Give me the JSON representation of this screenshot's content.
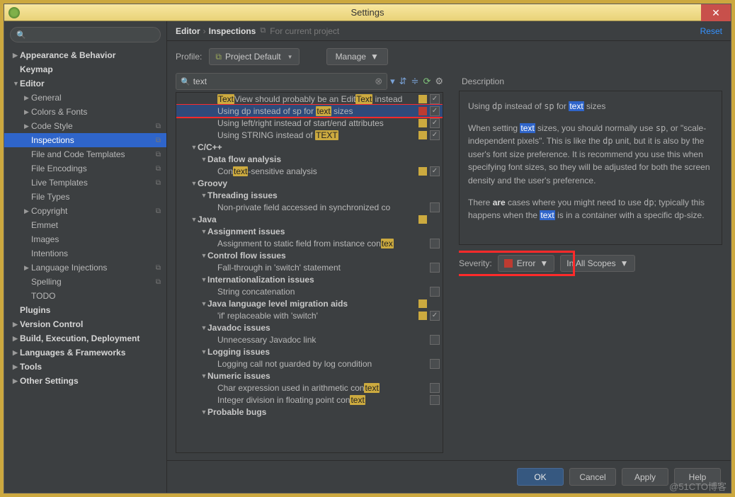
{
  "window": {
    "title": "Settings"
  },
  "breadcrumb": {
    "a": "Editor",
    "b": "Inspections",
    "proj": "For current project"
  },
  "reset": "Reset",
  "profile": {
    "label": "Profile:",
    "value": "Project Default"
  },
  "manage": "Manage",
  "search": {
    "value": "text"
  },
  "sidebar": {
    "items": [
      {
        "l": "Appearance & Behavior",
        "d": 0,
        "a": "▶",
        "b": 1
      },
      {
        "l": "Keymap",
        "d": 0,
        "b": 1
      },
      {
        "l": "Editor",
        "d": 0,
        "a": "▼",
        "b": 1
      },
      {
        "l": "General",
        "d": 1,
        "a": "▶"
      },
      {
        "l": "Colors & Fonts",
        "d": 1,
        "a": "▶"
      },
      {
        "l": "Code Style",
        "d": 1,
        "a": "▶",
        "c": 1
      },
      {
        "l": "Inspections",
        "d": 1,
        "sel": 1,
        "c": 1
      },
      {
        "l": "File and Code Templates",
        "d": 1,
        "c": 1
      },
      {
        "l": "File Encodings",
        "d": 1,
        "c": 1
      },
      {
        "l": "Live Templates",
        "d": 1,
        "c": 1
      },
      {
        "l": "File Types",
        "d": 1
      },
      {
        "l": "Copyright",
        "d": 1,
        "a": "▶",
        "c": 1
      },
      {
        "l": "Emmet",
        "d": 1
      },
      {
        "l": "Images",
        "d": 1
      },
      {
        "l": "Intentions",
        "d": 1
      },
      {
        "l": "Language Injections",
        "d": 1,
        "a": "▶",
        "c": 1
      },
      {
        "l": "Spelling",
        "d": 1,
        "c": 1
      },
      {
        "l": "TODO",
        "d": 1
      },
      {
        "l": "Plugins",
        "d": 0,
        "b": 1
      },
      {
        "l": "Version Control",
        "d": 0,
        "a": "▶",
        "b": 1
      },
      {
        "l": "Build, Execution, Deployment",
        "d": 0,
        "a": "▶",
        "b": 1
      },
      {
        "l": "Languages & Frameworks",
        "d": 0,
        "a": "▶",
        "b": 1
      },
      {
        "l": "Tools",
        "d": 0,
        "a": "▶",
        "b": 1
      },
      {
        "l": "Other Settings",
        "d": 0,
        "a": "▶",
        "b": 1
      }
    ]
  },
  "inspections": [
    {
      "d": 3,
      "html": "<span class='hl'>Text</span>View should probably be an Edit<span class='hl'>Text</span> instead",
      "sev": "warn",
      "chk": 1
    },
    {
      "d": 3,
      "html": "Using dp instead of sp for <span class='hl'>text</span> sizes",
      "sev": "err",
      "chk": 1,
      "sel": 1
    },
    {
      "d": 3,
      "html": "Using left/right instead of start/end attributes",
      "sev": "warn",
      "chk": 1
    },
    {
      "d": 3,
      "html": "Using STRING instead of <span class='hl'>TEXT</span>",
      "sev": "warn",
      "chk": 1
    },
    {
      "d": 1,
      "cat": "C/C++",
      "a": "▼"
    },
    {
      "d": 2,
      "cat": "Data flow analysis",
      "a": "▼"
    },
    {
      "d": 3,
      "html": "Con<span class='hl'>text</span>-sensitive analysis",
      "sev": "warn",
      "chk": 1
    },
    {
      "d": 1,
      "cat": "Groovy",
      "a": "▼"
    },
    {
      "d": 2,
      "cat": "Threading issues",
      "a": "▼"
    },
    {
      "d": 3,
      "html": "Non-private field accessed in synchronized co",
      "chk": 0
    },
    {
      "d": 1,
      "cat": "Java",
      "a": "▼",
      "sev": "warn"
    },
    {
      "d": 2,
      "cat": "Assignment issues",
      "a": "▼"
    },
    {
      "d": 3,
      "html": "Assignment to static field from instance con<span class='hl'>tex</span>",
      "chk": 0
    },
    {
      "d": 2,
      "cat": "Control flow issues",
      "a": "▼"
    },
    {
      "d": 3,
      "html": "Fall-through in 'switch' statement",
      "chk": 0
    },
    {
      "d": 2,
      "cat": "Internationalization issues",
      "a": "▼"
    },
    {
      "d": 3,
      "html": "String concatenation",
      "chk": 0
    },
    {
      "d": 2,
      "cat": "Java language level migration aids",
      "a": "▼",
      "sev": "warn"
    },
    {
      "d": 3,
      "html": "'if' replaceable with 'switch'",
      "sev": "warn",
      "chk": 1
    },
    {
      "d": 2,
      "cat": "Javadoc issues",
      "a": "▼"
    },
    {
      "d": 3,
      "html": "Unnecessary Javadoc link",
      "chk": 0
    },
    {
      "d": 2,
      "cat": "Logging issues",
      "a": "▼"
    },
    {
      "d": 3,
      "html": "Logging call not guarded by log condition",
      "chk": 0
    },
    {
      "d": 2,
      "cat": "Numeric issues",
      "a": "▼"
    },
    {
      "d": 3,
      "html": "Char expression used in arithmetic con<span class='hl'>text</span>",
      "chk": 0
    },
    {
      "d": 3,
      "html": "Integer division in floating point con<span class='hl'>text</span>",
      "chk": 0
    },
    {
      "d": 2,
      "cat": "Probable bugs",
      "a": "▼"
    }
  ],
  "desc": {
    "label": "Description",
    "title_html": "Using <code>dp</code> instead of <code>sp</code> for <span class='t-hl'>text</span> sizes",
    "p1_html": "When setting <span class='t-hl'>text</span> sizes, you should normally use <code>sp</code>, or \"scale-independent pixels\". This is like the <code>dp</code> unit, but it is also by the user's font size preference. It is recommend you use this when specifying font sizes, so they will be adjusted for both the screen density and the user's preference.",
    "p2_html": "There <b>are</b> cases where you might need to use <code>dp</code>; typically this happens when the <span class='t-hl'>text</span> is in a container with a specific dp-size."
  },
  "severity": {
    "label": "Severity:",
    "value": "Error",
    "scope": "In All Scopes"
  },
  "footer": {
    "ok": "OK",
    "cancel": "Cancel",
    "apply": "Apply",
    "help": "Help"
  },
  "watermark": "@51CTO博客"
}
